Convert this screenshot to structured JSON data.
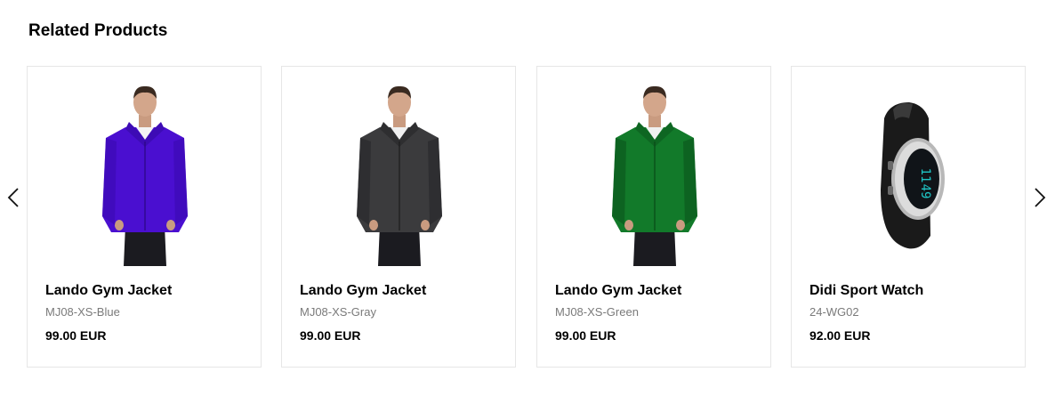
{
  "section": {
    "title": "Related Products"
  },
  "carousel": {
    "prev_icon": "chevron-left-icon",
    "next_icon": "chevron-right-icon"
  },
  "products": [
    {
      "name": "Lando Gym Jacket",
      "sku": "MJ08-XS-Blue",
      "price": "99.00 EUR",
      "image": "jacket-blue",
      "color": "#4a0fd0"
    },
    {
      "name": "Lando Gym Jacket",
      "sku": "MJ08-XS-Gray",
      "price": "99.00 EUR",
      "image": "jacket-gray",
      "color": "#3b3b3d"
    },
    {
      "name": "Lando Gym Jacket",
      "sku": "MJ08-XS-Green",
      "price": "99.00 EUR",
      "image": "jacket-green",
      "color": "#127a2a"
    },
    {
      "name": "Didi Sport Watch",
      "sku": "24-WG02",
      "price": "92.00 EUR",
      "image": "sport-watch",
      "color": "#1fc6c6"
    }
  ]
}
